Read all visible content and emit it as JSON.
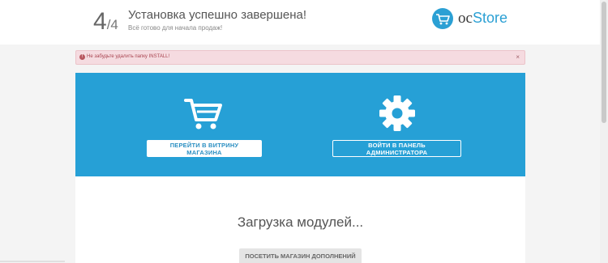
{
  "header": {
    "step_current": "4",
    "step_total": "/4",
    "title": "Установка успешно завершена!",
    "subtitle": "Всё готово для начала продаж!"
  },
  "logo": {
    "prefix": "oc",
    "name": "Store",
    "icon": "cart-logo-icon",
    "color": "#2ba0d4"
  },
  "alert": {
    "icon": "alert-icon",
    "text": "Не забудьте удалить папку INSTALL!",
    "close": "×",
    "color": "#f5dbe0"
  },
  "actions": {
    "shop_icon": "cart-icon",
    "shop_label": "ПЕРЕЙТИ В ВИТРИНУ МАГАЗИНА",
    "admin_icon": "gear-icon",
    "admin_label": "ВОЙТИ В ПАНЕЛЬ АДМИНИСТРАТОРА",
    "panel_color": "#26a0d6"
  },
  "modules": {
    "loading_text": "Загрузка модулей...",
    "store_button": "ПОСЕТИТЬ МАГАЗИН ДОПОЛНЕНИЙ"
  }
}
